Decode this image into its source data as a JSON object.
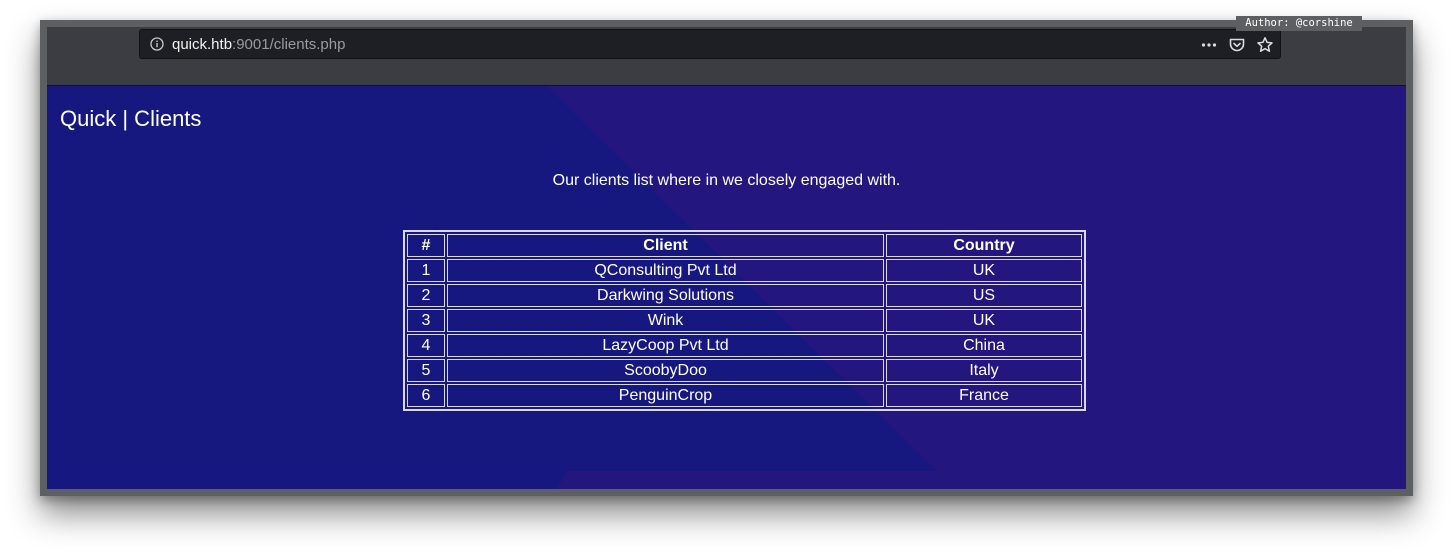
{
  "browser": {
    "url_host": "quick.htb",
    "url_rest": ":9001/clients.php",
    "icons": [
      "info-icon",
      "more-actions-icon",
      "pocket-icon",
      "bookmark-star-icon"
    ]
  },
  "author_tag": "Author: @corshine",
  "page": {
    "title": "Quick | Clients",
    "subtitle": "Our clients list where in we closely engaged with.",
    "colors": {
      "background": "#1a1882",
      "accent_shape": "#2a1880",
      "text": "#ffffff"
    }
  },
  "table": {
    "headers": [
      "#",
      "Client",
      "Country"
    ],
    "rows": [
      {
        "num": "1",
        "client": "QConsulting Pvt Ltd",
        "country": "UK"
      },
      {
        "num": "2",
        "client": "Darkwing Solutions",
        "country": "US"
      },
      {
        "num": "3",
        "client": "Wink",
        "country": "UK"
      },
      {
        "num": "4",
        "client": "LazyCoop Pvt Ltd",
        "country": "China"
      },
      {
        "num": "5",
        "client": "ScoobyDoo",
        "country": "Italy"
      },
      {
        "num": "6",
        "client": "PenguinCrop",
        "country": "France"
      }
    ]
  }
}
